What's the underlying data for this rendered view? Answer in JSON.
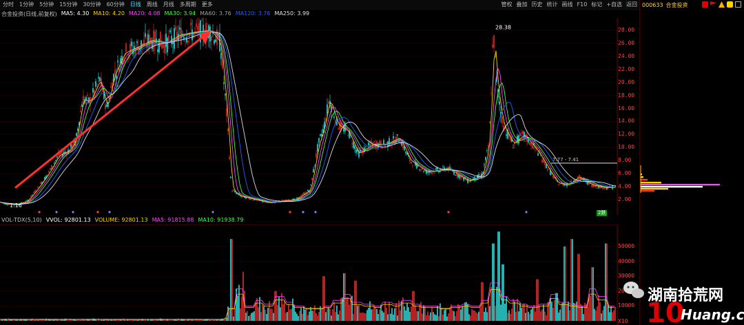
{
  "toolbar": {
    "periods": [
      "分时",
      "1分钟",
      "5分钟",
      "15分钟",
      "30分钟",
      "60分钟",
      "日线",
      "周线",
      "月线",
      "多周期",
      "更多"
    ],
    "active": "日线",
    "right_items": [
      "管权",
      "叠加",
      "历史",
      "统计",
      "画线",
      "F10",
      "标记",
      "+自选",
      "返回"
    ]
  },
  "stock": {
    "code": "000633",
    "name": "合金投资"
  },
  "ma_legend": {
    "title": "合金投资(日线,前复权)",
    "items": [
      {
        "label": "MA5: 4.30",
        "color": "#ffffff"
      },
      {
        "label": "MA10: 4.20",
        "color": "#ffd200"
      },
      {
        "label": "MA20: 4.08",
        "color": "#ff40ff"
      },
      {
        "label": "MA30: 3.94",
        "color": "#40ff40"
      },
      {
        "label": "MA60: 3.76",
        "color": "#a0a0a0"
      },
      {
        "label": "MA120: 3.76",
        "color": "#2060ff"
      },
      {
        "label": "MA250: 3.99",
        "color": "#e0e0e0"
      }
    ]
  },
  "vol_legend": {
    "title": "VOL-TDX(5,10)",
    "items": [
      {
        "label": "VVOL: 92801.13",
        "color": "#ffffff"
      },
      {
        "label": "VOLUME: 92801.13",
        "color": "#ffd200"
      },
      {
        "label": "MA5: 91815.88",
        "color": "#ff40ff"
      },
      {
        "label": "MA10: 91938.79",
        "color": "#40ff40"
      }
    ]
  },
  "price_axis": [
    "28.00",
    "26.00",
    "24.00",
    "22.00",
    "20.00",
    "18.00",
    "16.00",
    "14.00",
    "12.00",
    "10.00",
    "8.00",
    "6.00",
    "4.00",
    "2.00"
  ],
  "vol_axis": [
    "50000",
    "40000",
    "30000",
    "20000",
    "10000",
    "X10"
  ],
  "annotations": {
    "high": "28.38",
    "low": "1.16",
    "range": "7.77 - 7.41"
  },
  "badge": "2跌",
  "chart_data": {
    "type": "line",
    "title": "合金投资(日线,前复权)",
    "ylim": [
      0.5,
      29.5
    ],
    "price_path": [
      [
        0,
        1.6
      ],
      [
        10,
        1.3
      ],
      [
        25,
        1.2
      ],
      [
        40,
        1.8
      ],
      [
        55,
        3.8
      ],
      [
        70,
        6.0
      ],
      [
        85,
        8.8
      ],
      [
        100,
        9.5
      ],
      [
        110,
        11.0
      ],
      [
        120,
        17.5
      ],
      [
        130,
        17.0
      ],
      [
        145,
        20.5
      ],
      [
        155,
        16.0
      ],
      [
        165,
        21.0
      ],
      [
        180,
        24.5
      ],
      [
        200,
        25.5
      ],
      [
        220,
        26.5
      ],
      [
        240,
        26.0
      ],
      [
        260,
        27.3
      ],
      [
        285,
        27.8
      ],
      [
        305,
        28.0
      ],
      [
        320,
        26.0
      ],
      [
        330,
        14.0
      ],
      [
        336,
        3.5
      ],
      [
        350,
        2.5
      ],
      [
        370,
        2.0
      ],
      [
        390,
        1.5
      ],
      [
        410,
        1.8
      ],
      [
        430,
        2.0
      ],
      [
        450,
        3.5
      ],
      [
        462,
        10.5
      ],
      [
        470,
        13.0
      ],
      [
        478,
        17.5
      ],
      [
        490,
        13.5
      ],
      [
        505,
        12.5
      ],
      [
        520,
        9.0
      ],
      [
        540,
        10.5
      ],
      [
        560,
        10.5
      ],
      [
        580,
        11.5
      ],
      [
        595,
        8.0
      ],
      [
        620,
        6.2
      ],
      [
        650,
        6.8
      ],
      [
        680,
        4.8
      ],
      [
        700,
        5.8
      ],
      [
        710,
        10.5
      ],
      [
        716,
        27.8
      ],
      [
        722,
        19.0
      ],
      [
        730,
        13.5
      ],
      [
        745,
        10.5
      ],
      [
        760,
        12.0
      ],
      [
        780,
        9.5
      ],
      [
        800,
        6.0
      ],
      [
        810,
        4.5
      ],
      [
        825,
        4.3
      ],
      [
        840,
        5.5
      ],
      [
        860,
        4.2
      ],
      [
        880,
        3.8
      ],
      [
        896,
        4.0
      ]
    ],
    "volume_profile": [
      1,
      1,
      1,
      1,
      1,
      1,
      1,
      1,
      1,
      1,
      1,
      1,
      1,
      1,
      1,
      1,
      1,
      1,
      1,
      1,
      1,
      1,
      1,
      2,
      12,
      3,
      6,
      4,
      8,
      5,
      3,
      2,
      2,
      3,
      6,
      9,
      5,
      4,
      3,
      5,
      4,
      6,
      4,
      3,
      3,
      2,
      3,
      4,
      3,
      6,
      15,
      8,
      6,
      4,
      3,
      4,
      9,
      5,
      4,
      3,
      12,
      8,
      3
    ],
    "volume_peaks": [
      [
        336,
        55000
      ],
      [
        353,
        33000
      ],
      [
        400,
        20000
      ],
      [
        470,
        30000
      ],
      [
        500,
        32000
      ],
      [
        516,
        27000
      ],
      [
        600,
        20000
      ],
      [
        700,
        26000
      ],
      [
        716,
        52000
      ],
      [
        724,
        60000
      ],
      [
        730,
        38000
      ],
      [
        780,
        28000
      ],
      [
        820,
        50000
      ],
      [
        830,
        55000
      ],
      [
        840,
        45000
      ],
      [
        860,
        36000
      ],
      [
        880,
        52000
      ]
    ]
  }
}
